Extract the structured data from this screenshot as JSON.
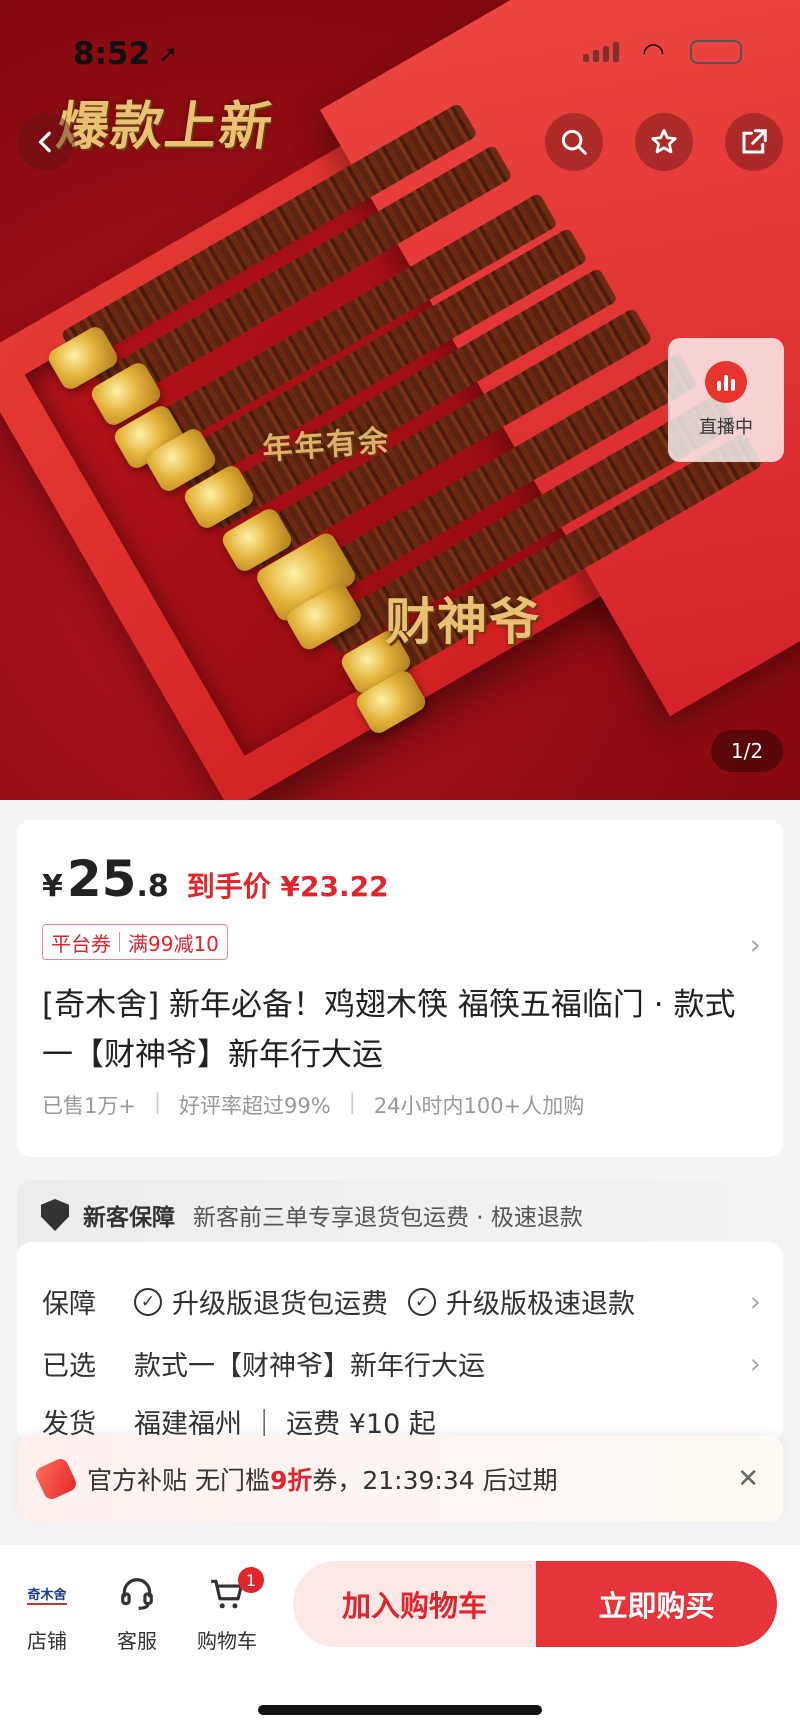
{
  "status_bar": {
    "time": "8:52",
    "location_icon": "location-arrow-icon"
  },
  "hero": {
    "overlay_title": "爆款上新",
    "overlay_sub1": "年年有余",
    "overlay_sub2": "财神爷",
    "live_label": "直播中",
    "pager": "1/2"
  },
  "price": {
    "currency": "¥",
    "integer": "25",
    "decimal": ".8",
    "final_price": "到手价 ¥23.22",
    "coupon_type": "平台券",
    "coupon_rule": "满99减10"
  },
  "product": {
    "title": "[奇木舍] 新年必备！鸡翅木筷 福筷五福临门 · 款式一【财神爷】新年行大运",
    "stat_sold": "已售1万+",
    "stat_rating": "好评率超过99%",
    "stat_cart": "24小时内100+人加购"
  },
  "guarantee": {
    "label": "新客保障",
    "text": "新客前三单专享退货包运费 · 极速退款"
  },
  "service": {
    "guarantee_label": "保障",
    "guarantee_item1": "升级版退货包运费",
    "guarantee_item2": "升级版极速退款",
    "selected_label": "已选",
    "selected_value": "款式一【财神爷】新年行大运",
    "ship_label": "发货",
    "ship_value": "福建福州 ｜ 运费 ¥10 起"
  },
  "subsidy": {
    "prefix": "官方补贴  无门槛",
    "discount": "9折",
    "suffix": "券，21:39:34 后过期"
  },
  "bottom_bar": {
    "shop_logo": "奇木舍",
    "shop_label": "店铺",
    "service_label": "客服",
    "cart_label": "购物车",
    "cart_count": "1",
    "add_to_cart": "加入购物车",
    "buy_now": "立即购买"
  },
  "colors": {
    "accent": "#e1252d",
    "buy_button": "#e5353b",
    "cart_button_bg": "#fde8e8"
  }
}
